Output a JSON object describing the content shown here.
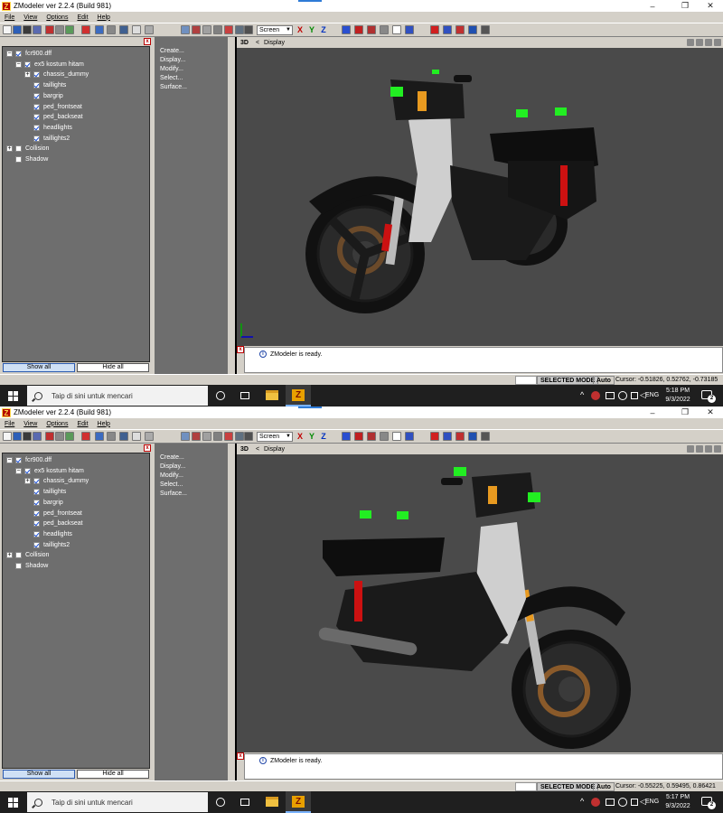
{
  "window": {
    "title": "ZModeler ver 2.2.4 (Build 981)",
    "minimize": "–",
    "maximize": "❐",
    "close": "✕"
  },
  "menu": [
    "File",
    "View",
    "Options",
    "Edit",
    "Help"
  ],
  "toolbar": {
    "view_mode": "Screen",
    "axis_x": "X",
    "axis_y": "Y",
    "axis_z": "Z"
  },
  "tree": [
    {
      "label": "fcr900.dff",
      "level": 0,
      "expander": "minus",
      "checked": true
    },
    {
      "label": "ex5 kostum hitam",
      "level": 1,
      "expander": "minus",
      "checked": true
    },
    {
      "label": "chassis_dummy",
      "level": 2,
      "expander": "plus",
      "checked": true
    },
    {
      "label": "taillights",
      "level": 2,
      "expander": "none",
      "checked": true
    },
    {
      "label": "bargrip",
      "level": 2,
      "expander": "none",
      "checked": true
    },
    {
      "label": "ped_frontseat",
      "level": 2,
      "expander": "none",
      "checked": true
    },
    {
      "label": "ped_backseat",
      "level": 2,
      "expander": "none",
      "checked": true
    },
    {
      "label": "headlights",
      "level": 2,
      "expander": "none",
      "checked": true
    },
    {
      "label": "taillights2",
      "level": 2,
      "expander": "none",
      "checked": true
    },
    {
      "label": "Collision",
      "level": 0,
      "expander": "plus",
      "checked": false
    },
    {
      "label": "Shadow",
      "level": 0,
      "expander": "none",
      "checked": false
    }
  ],
  "tree_buttons": {
    "show_all": "Show all",
    "hide_all": "Hide all"
  },
  "commands": [
    "Create...",
    "Display...",
    "Modify...",
    "Select...",
    "Surface..."
  ],
  "viewport": {
    "mode": "3D",
    "arrow": "<",
    "name": "Display"
  },
  "log": {
    "message": "ZModeler is ready."
  },
  "status": {
    "mode": "SELECTED MODE",
    "snap": "Auto"
  },
  "screens": [
    {
      "cursor": "Cursor: -0.51826, 0.52762, -0.73185",
      "time": "5:18 PM",
      "date": "9/3/2022"
    },
    {
      "cursor": "Cursor: -0.55225, 0.59495, 0.86421",
      "time": "5:17 PM",
      "date": "9/3/2022"
    }
  ],
  "taskbar": {
    "search_placeholder": "Taip di sini untuk mencari",
    "language": "ENG",
    "notifications": "2"
  },
  "colors": {
    "viewport_bg": "#4a4a4a",
    "panel_bg": "#6e6e6e",
    "chrome": "#d4d0c8",
    "taskbar": "#1f1f1f",
    "marker_green": "#22ee22",
    "spring_red": "#cc1111",
    "accent_orange": "#e89a20"
  },
  "icons": [
    "zmodeler-app-icon",
    "windows-start-icon",
    "search-icon",
    "task-view-icon",
    "timeline-icon",
    "file-explorer-icon",
    "zmodeler-taskbar-icon",
    "tray-chevron-icon",
    "network-icon",
    "speaker-icon",
    "notification-icon"
  ]
}
